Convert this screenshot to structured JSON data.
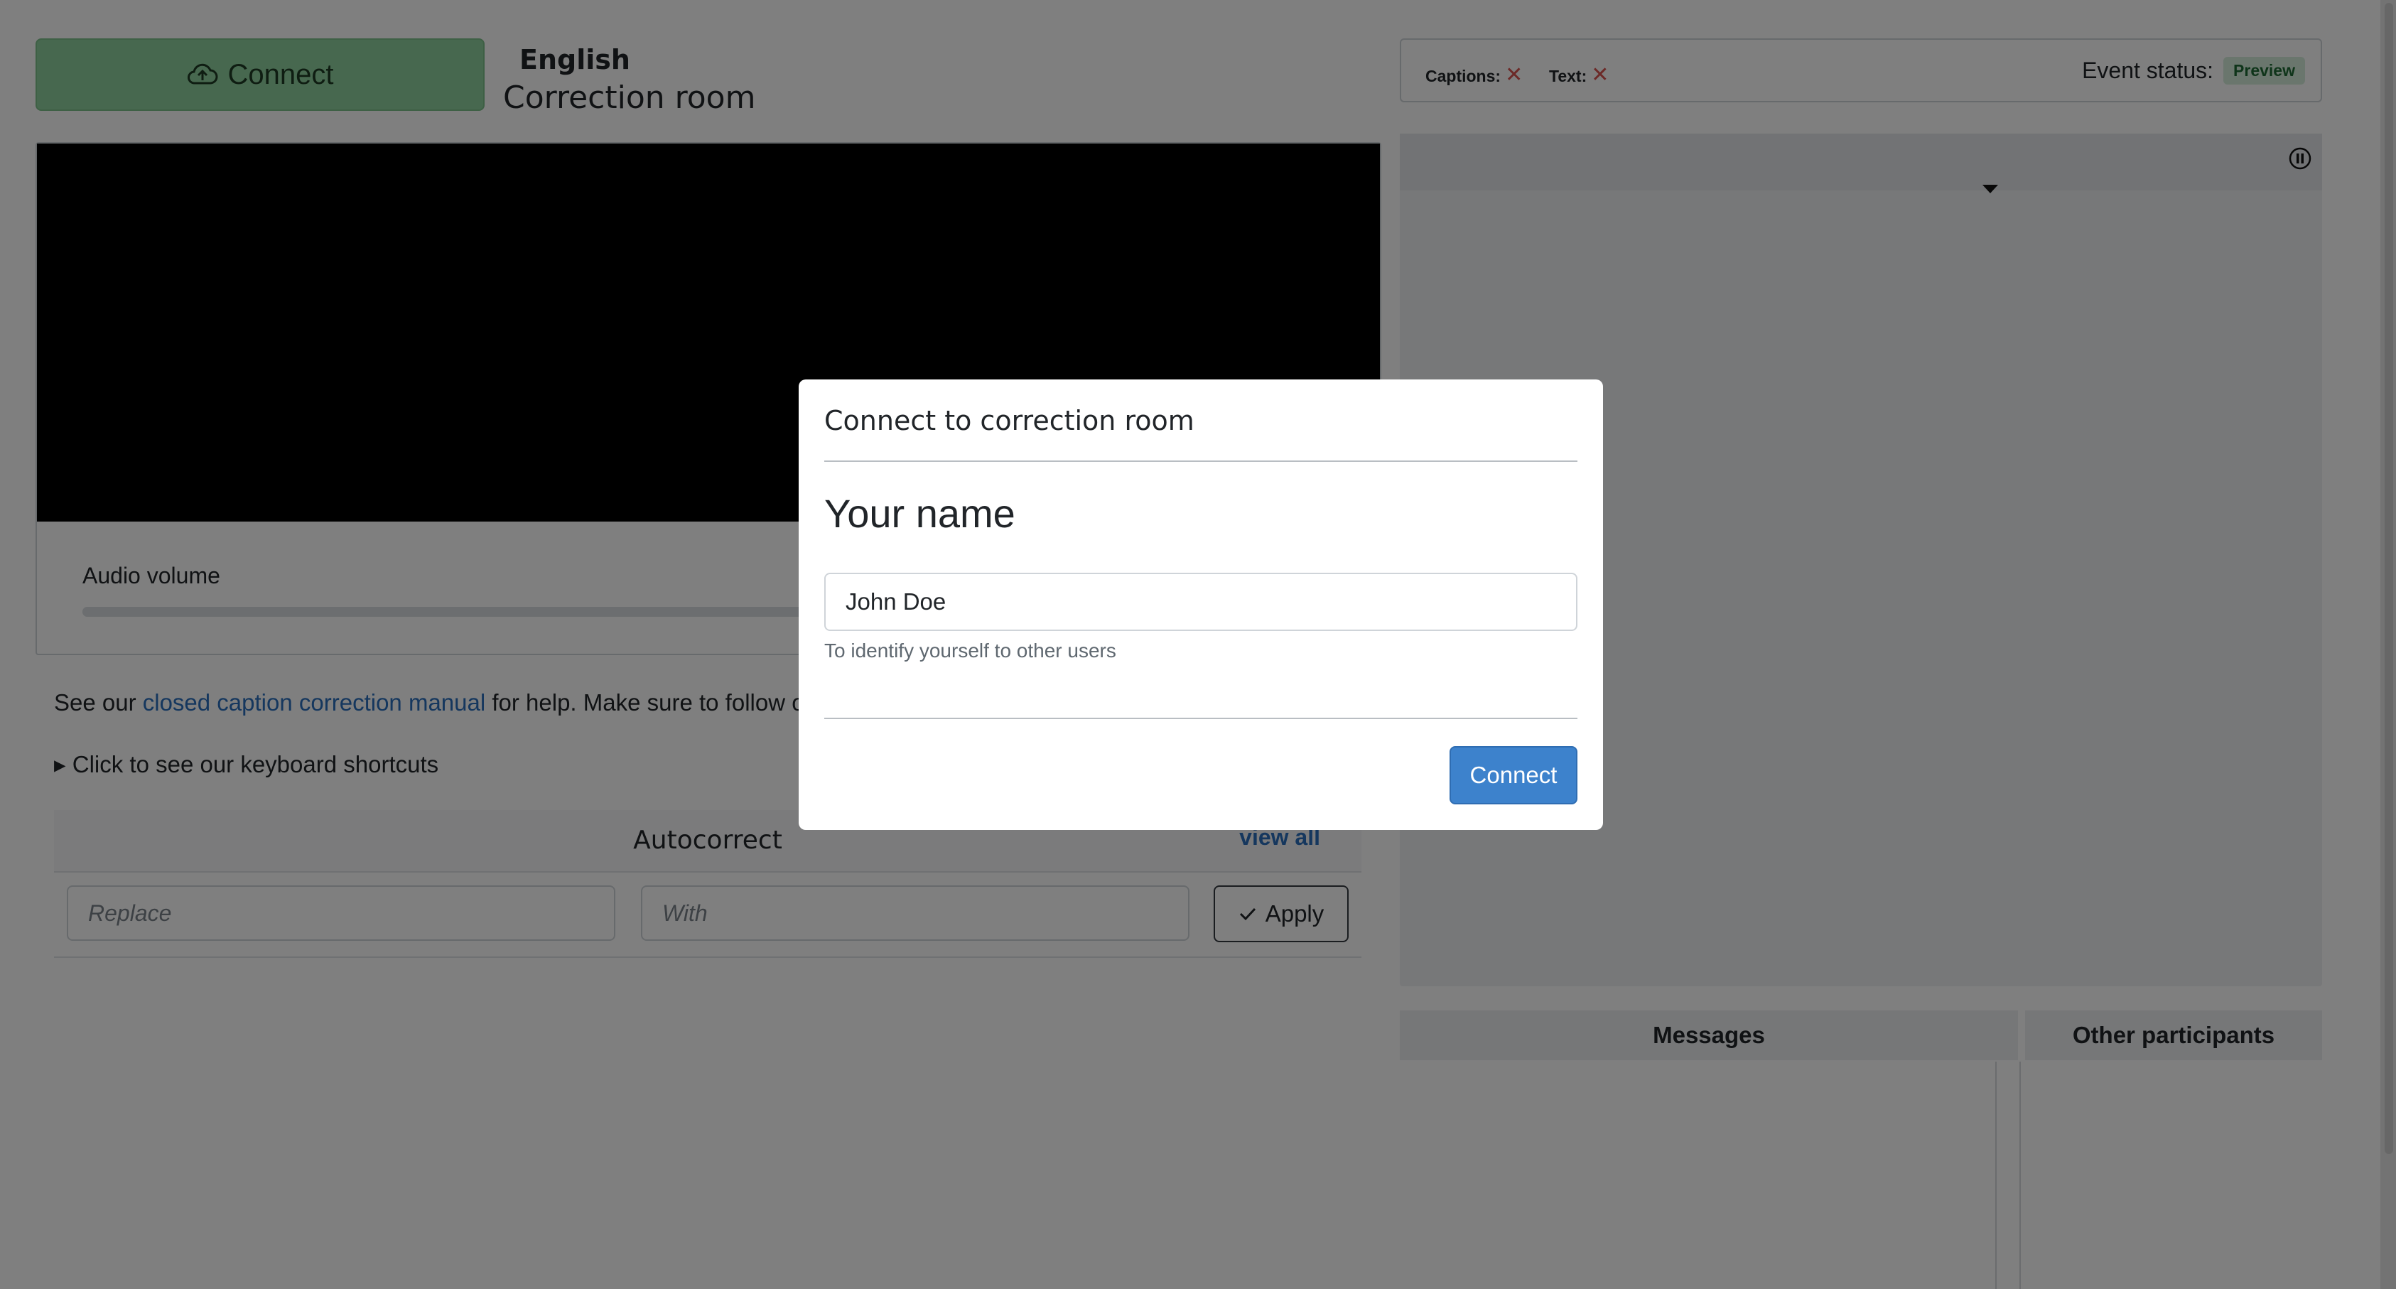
{
  "header": {
    "connect_label": "Connect",
    "language": "English",
    "room_name": "Correction room"
  },
  "audio": {
    "label": "Audio volume",
    "level": 1.0
  },
  "help": {
    "prefix": "See our ",
    "link_text": "closed caption correction manual",
    "suffix": " for help. Make sure to follow ou"
  },
  "shortcuts": {
    "label": "▸ Click to see our keyboard shortcuts"
  },
  "autocorrect": {
    "title": "Autocorrect",
    "view_all": "view all",
    "replace_placeholder": "Replace",
    "with_placeholder": "With",
    "apply_label": "Apply"
  },
  "status": {
    "captions_label": "Captions:",
    "text_label": "Text:",
    "event_status_label": "Event status:",
    "event_status_value": "Preview"
  },
  "panels": {
    "messages": "Messages",
    "participants": "Other participants"
  },
  "modal": {
    "title": "Connect to correction room",
    "name_label": "Your name",
    "name_value": "John Doe",
    "hint": "To identify yourself to other users",
    "connect_label": "Connect"
  },
  "icons": {
    "connect": "cloud-upload-icon",
    "apply": "check-icon",
    "captions_status": "x-icon",
    "text_status": "x-icon",
    "pause": "pause-circle-icon",
    "dropdown": "caret-down-icon"
  },
  "colors": {
    "connect_button": "#8fd19e",
    "primary": "#3d82cc",
    "link": "#2b6fbd",
    "badge_bg": "#d4edda",
    "error_x": "#d9534f"
  }
}
